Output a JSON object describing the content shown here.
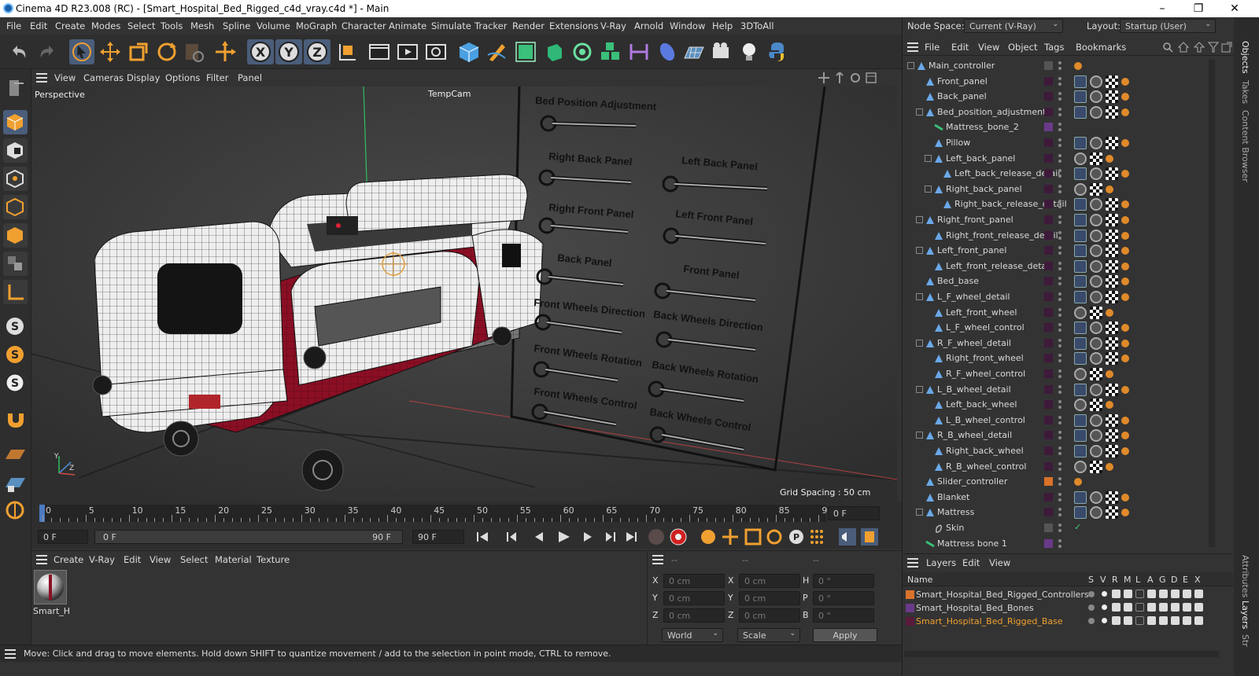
{
  "window": {
    "title": "Cinema 4D R23.008 (RC) - [Smart_Hospital_Bed_Rigged_c4d_vray.c4d *] - Main",
    "controls": [
      "–",
      "❐",
      "✕"
    ]
  },
  "menu": [
    "File",
    "Edit",
    "Create",
    "Modes",
    "Select",
    "Tools",
    "Mesh",
    "Spline",
    "Volume",
    "MoGraph",
    "Character",
    "Animate",
    "Simulate",
    "Tracker",
    "Render",
    "Extensions",
    "V-Ray",
    "Arnold",
    "Window",
    "Help",
    "3DToAll"
  ],
  "node_space": {
    "label": "Node Space:",
    "value": "Current (V-Ray)"
  },
  "layout": {
    "label": "Layout:",
    "value": "Startup (User)"
  },
  "toolbar": {
    "axis_x": "X",
    "axis_y": "Y",
    "axis_z": "Z"
  },
  "viewport": {
    "menu": [
      "View",
      "Cameras",
      "Display",
      "Options",
      "Filter",
      "Panel"
    ],
    "name": "Perspective",
    "camera": "TempCam",
    "grid_spacing": "Grid Spacing : 50 cm",
    "axis_y": "Y",
    "axis_z": "Z",
    "controls_left": [
      "Bed Position Adjustment",
      "Right Back Panel",
      "Right Front Panel",
      "Back Panel",
      "Front Wheels Direction",
      "Front Wheels Rotation",
      "Front Wheels Control"
    ],
    "controls_right": [
      "Left Back Panel",
      "Left Front Panel",
      "Front Panel",
      "Back Wheels Direction",
      "Back Wheels Rotation",
      "Back Wheels Control"
    ]
  },
  "timeline": {
    "ticks": [
      "0",
      "5",
      "10",
      "15",
      "20",
      "25",
      "30",
      "35",
      "40",
      "45",
      "50",
      "55",
      "60",
      "65",
      "70",
      "75",
      "80",
      "85",
      "90"
    ],
    "current_frame": "0 F"
  },
  "transport": {
    "start": "0 F",
    "range_start": "0 F",
    "range_end": "90 F",
    "end": "90 F"
  },
  "material_panel": {
    "menu": [
      "Create",
      "V-Ray",
      "Edit",
      "View",
      "Select",
      "Material",
      "Texture"
    ],
    "material_name": "Smart_H"
  },
  "coords": {
    "headers": [
      "--",
      "--",
      "--"
    ],
    "rows": [
      {
        "a": "X",
        "av": "0 cm",
        "b": "X",
        "bv": "0 cm",
        "c": "H",
        "cv": "0 °"
      },
      {
        "a": "Y",
        "av": "0 cm",
        "b": "Y",
        "bv": "0 cm",
        "c": "P",
        "cv": "0 °"
      },
      {
        "a": "Z",
        "av": "0 cm",
        "b": "Z",
        "bv": "0 cm",
        "c": "B",
        "cv": "0 °"
      }
    ],
    "world": "World",
    "scale": "Scale",
    "apply": "Apply"
  },
  "status": "Move: Click and drag to move elements. Hold down SHIFT to quantize movement / add to the selection in point mode, CTRL to remove.",
  "objects_panel": {
    "menu": [
      "File",
      "Edit",
      "View",
      "Object",
      "Tags",
      "Bookmarks"
    ],
    "items": [
      {
        "name": "Main_controller",
        "depth": 0,
        "type": "ctrl"
      },
      {
        "name": "Front_panel",
        "depth": 1,
        "type": "bone"
      },
      {
        "name": "Back_panel",
        "depth": 1,
        "type": "bone"
      },
      {
        "name": "Bed_position_adjustment",
        "depth": 1,
        "type": "bone"
      },
      {
        "name": "Mattress_bone_2",
        "depth": 2,
        "type": "line"
      },
      {
        "name": "Pillow",
        "depth": 2,
        "type": "bone"
      },
      {
        "name": "Left_back_panel",
        "depth": 2,
        "type": "bone"
      },
      {
        "name": "Left_back_release_detail",
        "depth": 3,
        "type": "bone"
      },
      {
        "name": "Right_back_panel",
        "depth": 2,
        "type": "bone"
      },
      {
        "name": "Right_back_release_detail",
        "depth": 3,
        "type": "bone"
      },
      {
        "name": "Right_front_panel",
        "depth": 1,
        "type": "bone"
      },
      {
        "name": "Right_front_release_detail",
        "depth": 2,
        "type": "bone"
      },
      {
        "name": "Left_front_panel",
        "depth": 1,
        "type": "bone"
      },
      {
        "name": "Left_front_release_detail",
        "depth": 2,
        "type": "bone"
      },
      {
        "name": "Bed_base",
        "depth": 1,
        "type": "bone"
      },
      {
        "name": "L_F_wheel_detail",
        "depth": 1,
        "type": "bone"
      },
      {
        "name": "Left_front_wheel",
        "depth": 2,
        "type": "bone"
      },
      {
        "name": "L_F_wheel_control",
        "depth": 2,
        "type": "bone"
      },
      {
        "name": "R_F_wheel_detail",
        "depth": 1,
        "type": "bone"
      },
      {
        "name": "Right_front_wheel",
        "depth": 2,
        "type": "bone"
      },
      {
        "name": "R_F_wheel_control",
        "depth": 2,
        "type": "bone"
      },
      {
        "name": "L_B_wheel_detail",
        "depth": 1,
        "type": "bone"
      },
      {
        "name": "Left_back_wheel",
        "depth": 2,
        "type": "bone"
      },
      {
        "name": "L_B_wheel_control",
        "depth": 2,
        "type": "bone"
      },
      {
        "name": "R_B_wheel_detail",
        "depth": 1,
        "type": "bone"
      },
      {
        "name": "Right_back_wheel",
        "depth": 2,
        "type": "bone"
      },
      {
        "name": "R_B_wheel_control",
        "depth": 2,
        "type": "bone"
      },
      {
        "name": "Slider_controller",
        "depth": 1,
        "type": "ctrl"
      },
      {
        "name": "Blanket",
        "depth": 1,
        "type": "bone"
      },
      {
        "name": "Mattress",
        "depth": 1,
        "type": "bone"
      },
      {
        "name": "Skin",
        "depth": 2,
        "type": "skin"
      },
      {
        "name": "Mattress bone 1",
        "depth": 1,
        "type": "line"
      }
    ]
  },
  "layers_panel": {
    "menu": [
      "Layers",
      "Edit",
      "View"
    ],
    "name_header": "Name",
    "flag_headers": [
      "S",
      "V",
      "R",
      "M",
      "L",
      "A",
      "G",
      "D",
      "E",
      "X"
    ],
    "layers": [
      {
        "name": "Smart_Hospital_Bed_Rigged_Controllers",
        "color": "#d9722a",
        "highlight": false
      },
      {
        "name": "Smart_Hospital_Bed_Bones",
        "color": "#6a3a8a",
        "highlight": false
      },
      {
        "name": "Smart_Hospital_Bed_Rigged_Base",
        "color": "#5a1a3a",
        "highlight": true
      }
    ]
  },
  "side_tabs": [
    "Objects",
    "Takes",
    "Content Browser",
    "Attributes",
    "Layers",
    "Str"
  ]
}
